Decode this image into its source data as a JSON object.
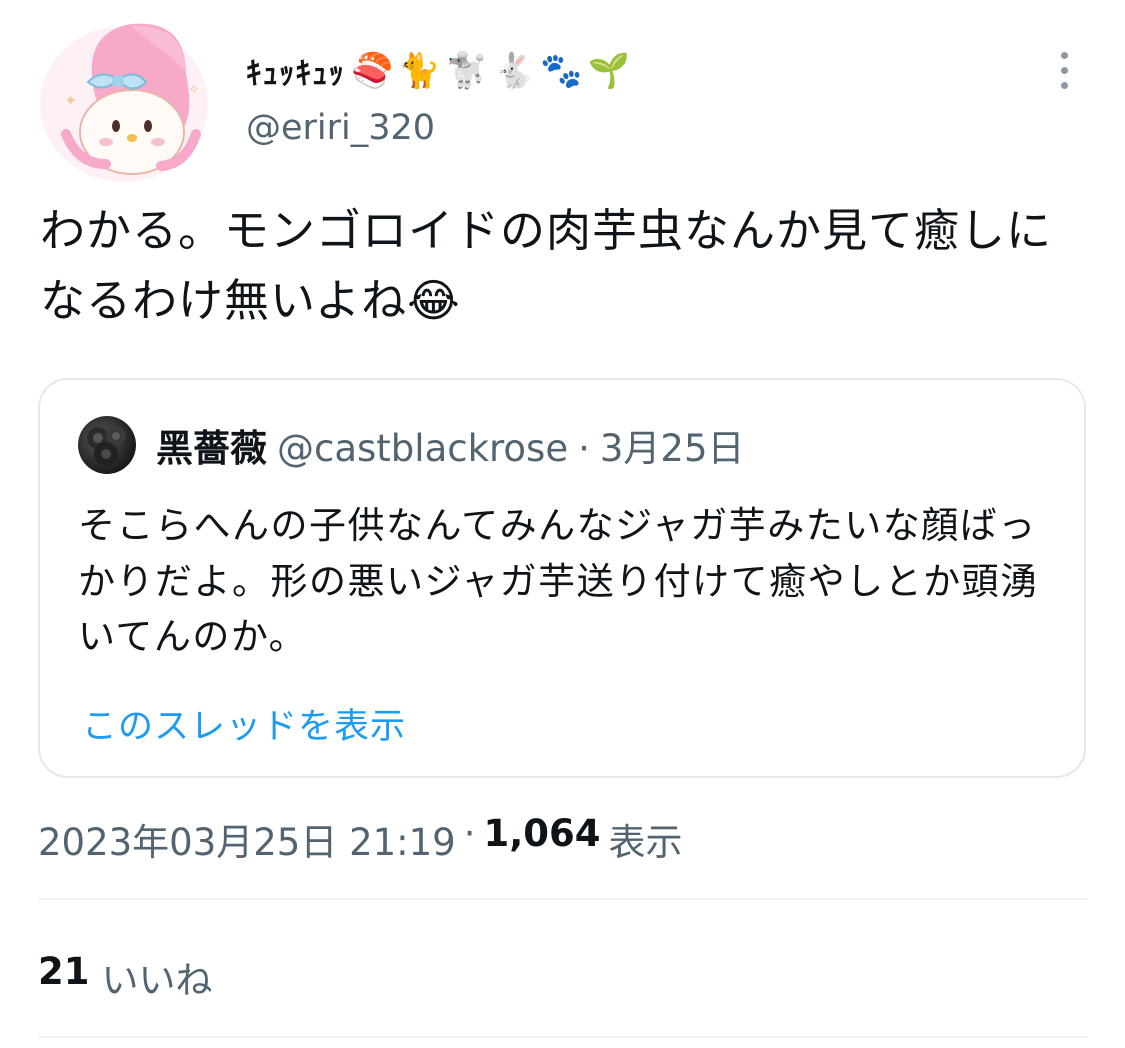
{
  "tweet": {
    "display_name": "ｷｭｯｷｭｯ",
    "name_emojis": [
      "🍣",
      "🐈",
      "🐩",
      "🐇",
      "🐾",
      "🌱"
    ],
    "handle": "@eriri_320",
    "text": "わかる。モンゴロイドの肉芋虫なんか見て癒しになるわけ無いよね😂",
    "timestamp": "2023年03月25日 21:19",
    "separator": "·",
    "views_count": "1,064",
    "views_label": "表示",
    "likes_count": "21",
    "likes_label": "いいね"
  },
  "quote": {
    "name": "黑薔薇",
    "handle": "@castblackrose",
    "separator": "·",
    "date": "3月25日",
    "text": "そこらへんの子供なんてみんなジャガ芋みたいな顔ばっかりだよ。形の悪いジャガ芋送り付けて癒やしとか頭湧いてんのか。",
    "thread_link": "このスレッドを表示"
  },
  "colors": {
    "text_primary": "#0f1419",
    "text_secondary": "#536471",
    "link": "#1d9bf0",
    "border": "#e3e8eb",
    "divider": "#eff3f4"
  },
  "icons": {
    "more": "more-vertical-icon"
  }
}
